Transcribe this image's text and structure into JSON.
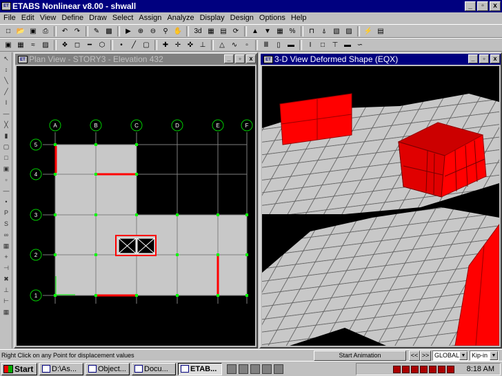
{
  "app": {
    "title": "ETABS Nonlinear v8.00 - shwall",
    "icon": "etabs-icon"
  },
  "window_buttons": {
    "minimize": "_",
    "maximize": "▫",
    "close": "x"
  },
  "menu": [
    "File",
    "Edit",
    "View",
    "Define",
    "Draw",
    "Select",
    "Assign",
    "Analyze",
    "Display",
    "Design",
    "Options",
    "Help"
  ],
  "toolbar_row1": [
    "new-icon",
    "open-icon",
    "save-icon",
    "print-icon",
    "undo-icon",
    "redo-icon",
    "pencil-icon",
    "lock-icon",
    "run-icon",
    "zoom-in-icon",
    "zoom-out-icon",
    "zoom-window-icon",
    "pan-icon",
    "3d-icon",
    "plan-icon",
    "elevation-icon",
    "rotate-icon",
    "up-icon",
    "down-icon",
    "grid-icon"
  ],
  "toolbar_row1_labels": {
    "three_d": "3d",
    "percent": "%"
  },
  "plan_view": {
    "title": "Plan View - STORY3 - Elevation 432",
    "grid_columns": [
      "A",
      "B",
      "C",
      "D",
      "E",
      "F"
    ],
    "grid_rows": [
      "5",
      "4",
      "3",
      "2",
      "1"
    ]
  },
  "view3d": {
    "title": "3-D View  Deformed Shape (EQX)"
  },
  "status": {
    "message": "Right Click on any Point for displacement values",
    "start_animation": "Start Animation",
    "prev": "<<",
    "next": ">>",
    "coord_system": "GLOBAL",
    "units": "Kip-in"
  },
  "taskbar": {
    "start": "Start",
    "tasks": [
      {
        "label": "D:\\As...",
        "active": false
      },
      {
        "label": "Object...",
        "active": false
      },
      {
        "label": "Docu...",
        "active": false
      },
      {
        "label": "ETAB...",
        "active": true
      }
    ],
    "time": "8:18 AM"
  },
  "colors": {
    "title_active": "#00007f",
    "title_inactive": "#808080",
    "slab": "#c8c8c8",
    "wall": "#ff0000",
    "point": "#00ff00",
    "grid": "#808080",
    "bubble": "#00cc00"
  }
}
